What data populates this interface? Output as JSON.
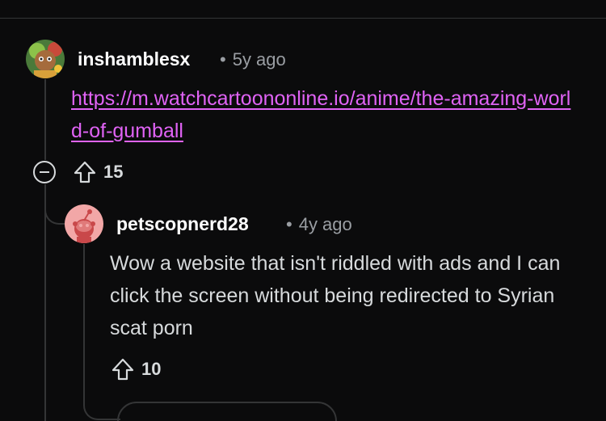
{
  "comments": [
    {
      "username": "inshamblesx",
      "separator": "•",
      "age": "5y ago",
      "link": "https://m.watchcartoononline.io/anime/the-amazing-world-of-gumball",
      "votes": "15",
      "avatar_icon": "snoo-avatar-green"
    },
    {
      "username": "petscopnerd28",
      "separator": "•",
      "age": "4y ago",
      "body": "Wow a website that isn't riddled with ads and I can click the screen without being redirected to Syrian scat porn",
      "votes": "10",
      "avatar_icon": "snoo-avatar-pink"
    }
  ],
  "more_replies_label": "",
  "colors": {
    "background": "#0b0b0c",
    "link": "#e063f5",
    "thread_line": "#343536",
    "meta_text": "#9a9ea3"
  }
}
